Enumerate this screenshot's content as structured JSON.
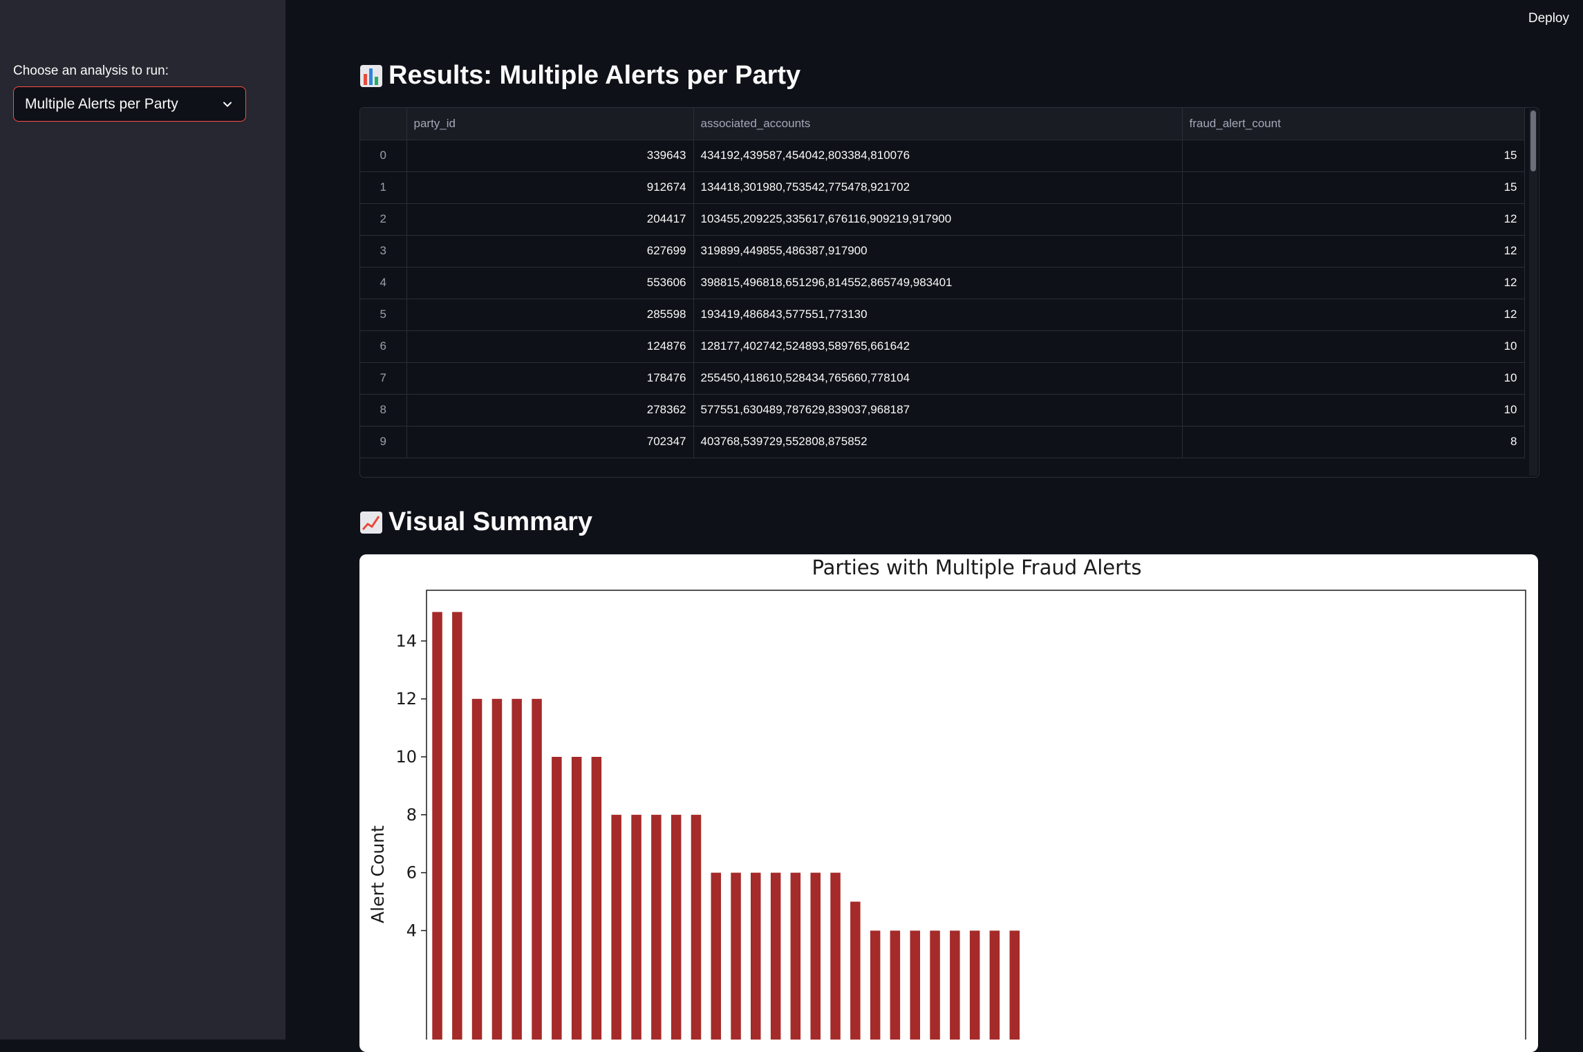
{
  "sidebar": {
    "label": "Choose an analysis to run:",
    "selected": "Multiple Alerts per Party"
  },
  "header": {
    "deploy_label": "Deploy"
  },
  "results": {
    "heading": "Results: Multiple Alerts per Party",
    "columns": [
      "",
      "party_id",
      "associated_accounts",
      "fraud_alert_count"
    ],
    "rows": [
      {
        "index": "0",
        "party_id": "339643",
        "associated_accounts": "434192,439587,454042,803384,810076",
        "fraud_alert_count": "15"
      },
      {
        "index": "1",
        "party_id": "912674",
        "associated_accounts": "134418,301980,753542,775478,921702",
        "fraud_alert_count": "15"
      },
      {
        "index": "2",
        "party_id": "204417",
        "associated_accounts": "103455,209225,335617,676116,909219,917900",
        "fraud_alert_count": "12"
      },
      {
        "index": "3",
        "party_id": "627699",
        "associated_accounts": "319899,449855,486387,917900",
        "fraud_alert_count": "12"
      },
      {
        "index": "4",
        "party_id": "553606",
        "associated_accounts": "398815,496818,651296,814552,865749,983401",
        "fraud_alert_count": "12"
      },
      {
        "index": "5",
        "party_id": "285598",
        "associated_accounts": "193419,486843,577551,773130",
        "fraud_alert_count": "12"
      },
      {
        "index": "6",
        "party_id": "124876",
        "associated_accounts": "128177,402742,524893,589765,661642",
        "fraud_alert_count": "10"
      },
      {
        "index": "7",
        "party_id": "178476",
        "associated_accounts": "255450,418610,528434,765660,778104",
        "fraud_alert_count": "10"
      },
      {
        "index": "8",
        "party_id": "278362",
        "associated_accounts": "577551,630489,787629,839037,968187",
        "fraud_alert_count": "10"
      },
      {
        "index": "9",
        "party_id": "702347",
        "associated_accounts": "403768,539729,552808,875852",
        "fraud_alert_count": "8"
      }
    ]
  },
  "visual": {
    "heading": "Visual Summary"
  },
  "chart_data": {
    "type": "bar",
    "title": "Parties with Multiple Fraud Alerts",
    "xlabel": "",
    "ylabel": "Alert Count",
    "ylim": [
      0,
      15.75
    ],
    "yticks": [
      4,
      6,
      8,
      10,
      12,
      14
    ],
    "bar_color": "#a52a2a",
    "values": [
      15,
      15,
      12,
      12,
      12,
      12,
      10,
      10,
      10,
      8,
      8,
      8,
      8,
      8,
      6,
      6,
      6,
      6,
      6,
      6,
      6,
      5,
      4,
      4,
      4,
      4,
      4,
      4,
      4,
      4
    ]
  },
  "colors": {
    "background": "#0e1117",
    "sidebar": "#262730",
    "accent": "#ff4b4b"
  }
}
